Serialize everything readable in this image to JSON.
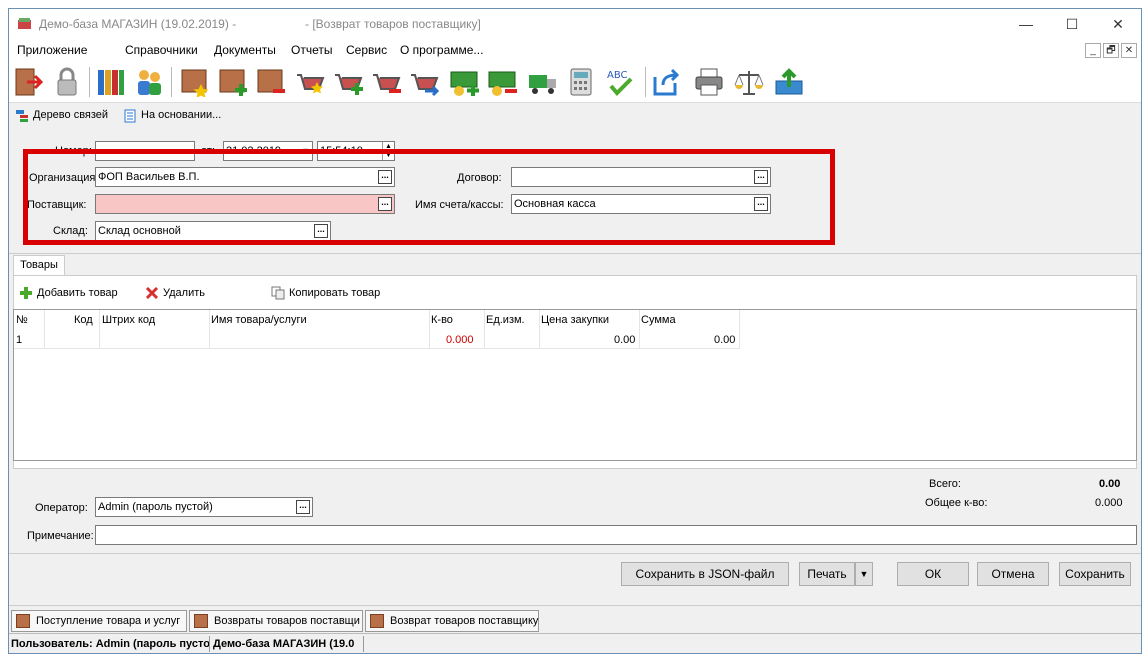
{
  "window": {
    "app_title": "Демо-база МАГАЗИН (19.02.2019) -",
    "doc_title": "- [Возврат товаров поставщику]",
    "minimize": "—",
    "maximize": "☐",
    "close": "✕"
  },
  "menu": [
    "Приложение",
    "Справочники",
    "Документы",
    "Отчеты",
    "Сервис",
    "О программе..."
  ],
  "mdi": {
    "minimize": "_",
    "restore": "🗗",
    "close": "✕"
  },
  "toolbar_icons": [
    "exit-icon",
    "lock-icon",
    "books-icon",
    "users-icon",
    "box-star-icon",
    "box-add-icon",
    "box-remove-icon",
    "cart-star-icon",
    "cart-add-icon",
    "cart-remove-icon",
    "cart-move-icon",
    "money-add-icon",
    "money-remove-icon",
    "truck-icon",
    "calculator-icon",
    "spellcheck-icon",
    "export-icon",
    "printer-icon",
    "scales-icon",
    "upload-icon"
  ],
  "actions": {
    "tree": "Дерево связей",
    "based_on": "На основании..."
  },
  "form": {
    "number_label": "Номер:",
    "number_value": "",
    "from_label": "от:",
    "date": "21.02.2019",
    "time": "15:54:10",
    "org_label": "Организация:",
    "org_value": "ФОП Васильев В.П.",
    "supplier_label": "Поставщик:",
    "supplier_value": "",
    "warehouse_label": "Склад:",
    "warehouse_value": "Склад основной",
    "contract_label": "Договор:",
    "contract_value": "",
    "account_label": "Имя счета/кассы:",
    "account_value": "Основная касса",
    "ellipsis": "..."
  },
  "tab": "Товары",
  "goods_toolbar": {
    "add": "Добавить товар",
    "delete": "Удалить",
    "copy": "Копировать товар"
  },
  "grid": {
    "columns": [
      "№",
      "Код",
      "Штрих код",
      "Имя товара/услуги",
      "К-во",
      "Ед.изм.",
      "Цена закупки",
      "Сумма"
    ],
    "row": {
      "num": "1",
      "qty": "0.000",
      "price": "0.00",
      "sum": "0.00"
    }
  },
  "totals": {
    "total_label": "Всего:",
    "total_value": "0.00",
    "qty_label": "Общее к-во:",
    "qty_value": "0.000"
  },
  "operator": {
    "label": "Оператор:",
    "value": "Admin (пароль пустой)"
  },
  "note": {
    "label": "Примечание:",
    "value": ""
  },
  "buttons": {
    "save_json": "Сохранить в JSON-файл",
    "print": "Печать",
    "ok": "ОК",
    "cancel": "Отмена",
    "save": "Сохранить"
  },
  "taskbar": [
    "Поступление товара и услуг",
    "Возвраты товаров поставщи",
    "Возврат товаров поставщику"
  ],
  "status": {
    "user": "Пользователь: Admin (пароль пусто",
    "db": "Демо-база МАГАЗИН (19.0"
  },
  "colors": {
    "highlight": "#d80000",
    "required_field": "#f9c6c6",
    "quantity_text": "#cc0000"
  }
}
